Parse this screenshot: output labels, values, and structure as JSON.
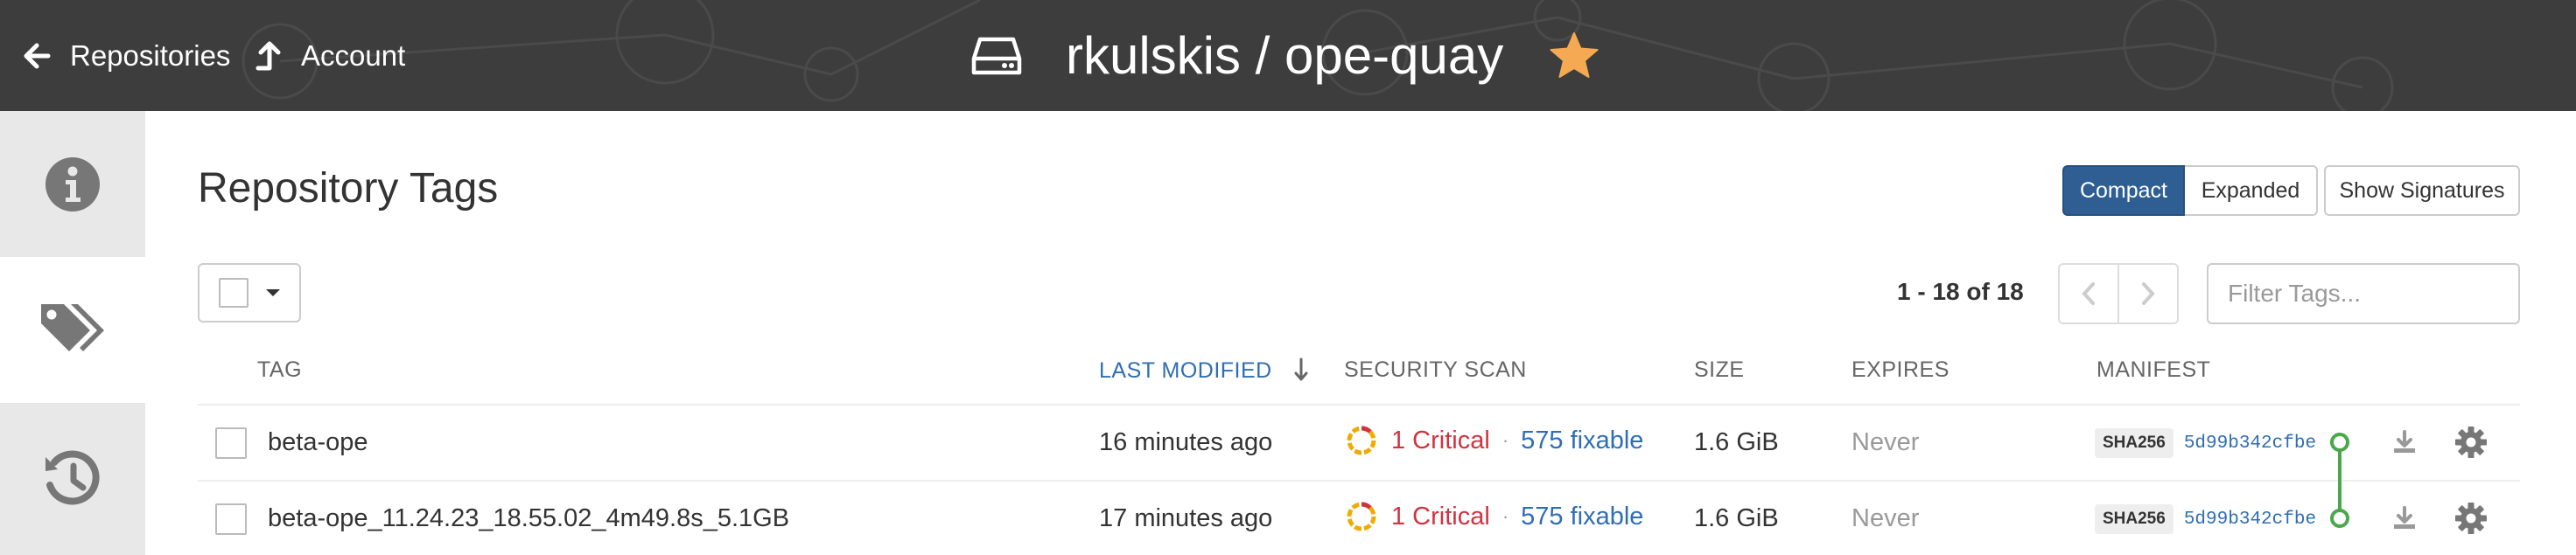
{
  "header": {
    "back_label": "Repositories",
    "account_label": "Account",
    "repo_title": "rkulskis / ope-quay",
    "icons": {
      "back": "arrow-left-icon",
      "account": "arrow-up-icon",
      "repo": "hard-drive-icon",
      "star": "star-icon"
    },
    "colors": {
      "background": "#3d3d3d",
      "star": "#f5a952"
    }
  },
  "sidebar": {
    "tabs": [
      {
        "name": "info",
        "icon": "info-circle-icon",
        "active": false
      },
      {
        "name": "tags",
        "icon": "tags-icon",
        "active": true
      },
      {
        "name": "history",
        "icon": "history-icon",
        "active": false
      }
    ]
  },
  "main": {
    "title": "Repository Tags",
    "view_modes": {
      "compact": "Compact",
      "expanded": "Expanded",
      "signatures": "Show Signatures",
      "active": "Compact"
    },
    "pagination": {
      "text": "1 - 18 of 18"
    },
    "filter_placeholder": "Filter Tags...",
    "columns": {
      "tag": "TAG",
      "last_modified": "LAST MODIFIED",
      "security_scan": "SECURITY SCAN",
      "size": "SIZE",
      "expires": "EXPIRES",
      "manifest": "MANIFEST"
    },
    "sort": {
      "column": "last_modified",
      "direction": "descending"
    },
    "rows": [
      {
        "tag": "beta-ope",
        "last_modified": "16 minutes ago",
        "critical": "1 Critical",
        "separator": "·",
        "fixable": "575 fixable",
        "size": "1.6 GiB",
        "expires": "Never",
        "manifest_label": "SHA256",
        "manifest_digest": "5d99b342cfbe"
      },
      {
        "tag": "beta-ope_11.24.23_18.55.02_4m49.8s_5.1GB",
        "last_modified": "17 minutes ago",
        "critical": "1 Critical",
        "separator": "·",
        "fixable": "575 fixable",
        "size": "1.6 GiB",
        "expires": "Never",
        "manifest_label": "SHA256",
        "manifest_digest": "5d99b342cfbe"
      }
    ],
    "colors": {
      "critical": "#d0333f",
      "link": "#2f6db4",
      "primary_button": "#2f5e93",
      "connector": "#4aa84a"
    }
  }
}
